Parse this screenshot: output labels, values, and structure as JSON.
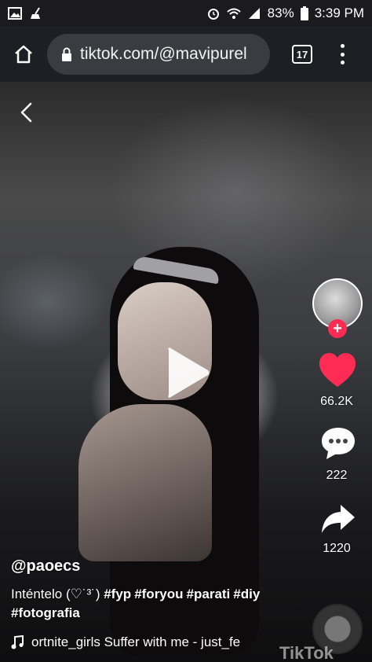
{
  "status_bar": {
    "left_icons": [
      "image-icon",
      "broom-icon"
    ],
    "right_icons": [
      "alarm-icon",
      "wifi-icon",
      "signal-icon",
      "battery-icon"
    ],
    "battery": "83%",
    "time": "3:39 PM"
  },
  "browser": {
    "url": "tiktok.com/@mavipurel",
    "tab_count": "17"
  },
  "video": {
    "playing": false
  },
  "actions": {
    "likes": "66.2K",
    "comments": "222",
    "shares": "1220",
    "like_color": "#fe2c55"
  },
  "post": {
    "username": "@paoecs",
    "caption_text": "Inténtelo (♡˙³˙) ",
    "hashtags": [
      "#fyp",
      "#foryou",
      "#parati",
      "#diy",
      "#fotografia"
    ],
    "music": "ortnite_girls      Suffer with me - just_fe"
  },
  "watermark": "TikTok"
}
